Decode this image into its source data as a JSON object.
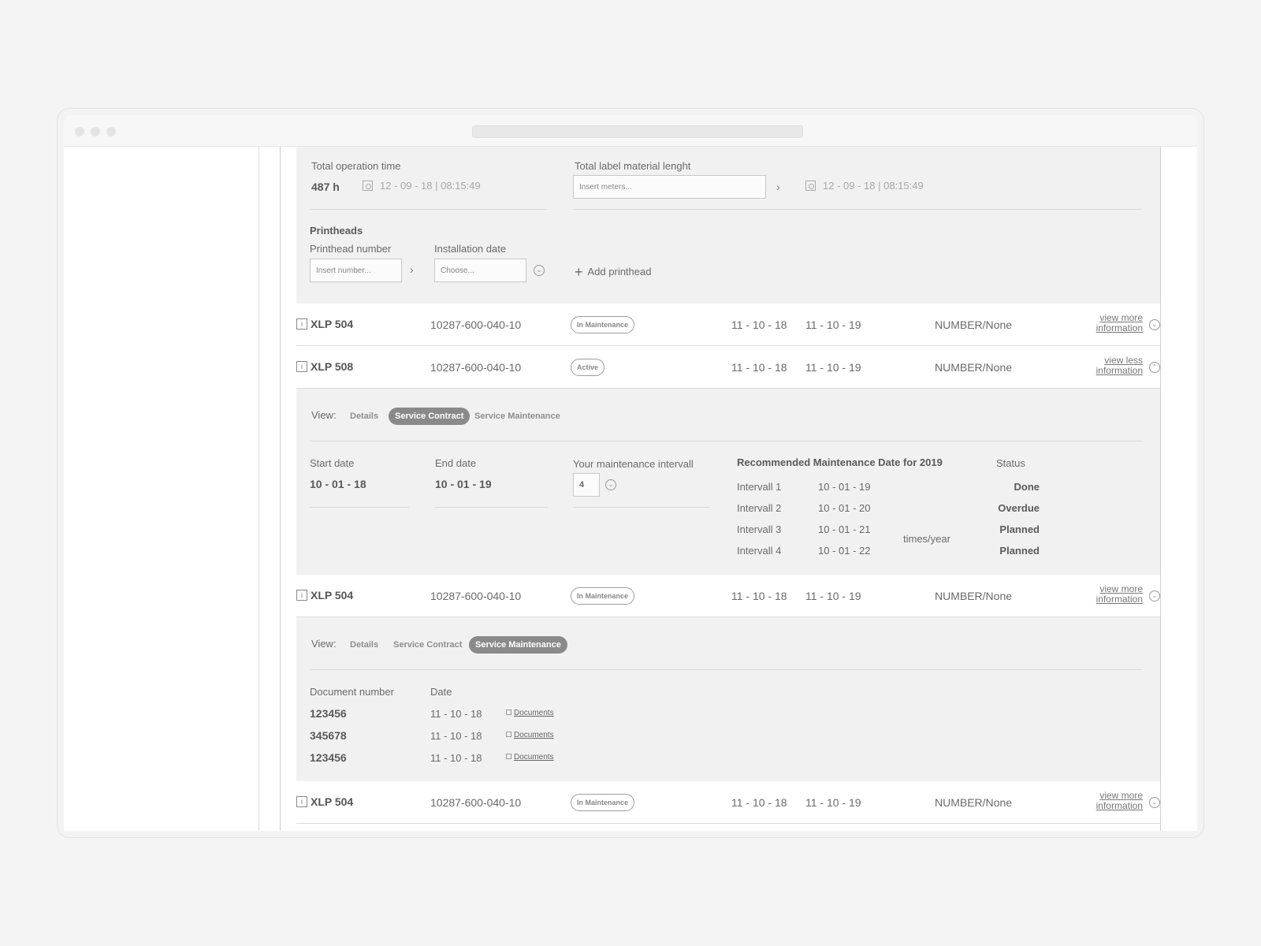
{
  "stats": {
    "operation_time_label": "Total operation time",
    "operation_time_value": "487 h",
    "operation_time_stamp": "12 - 09 - 18 | 08:15:49",
    "label_material_label": "Total label material lenght",
    "label_material_placeholder": "Insert meters...",
    "label_material_stamp": "12 - 09 - 18 | 08:15:49"
  },
  "printheads": {
    "title": "Printheads",
    "number_label": "Printhead number",
    "number_placeholder": "Insert number...",
    "date_label": "Installation date",
    "date_placeholder": "Choose...",
    "add_label": "Add printhead"
  },
  "rows": [
    {
      "name": "XLP 504",
      "serial": "10287-600-040-10",
      "status": "In Maintenance",
      "start": "11 - 10 - 18",
      "end": "11 - 10 - 19",
      "number": "NUMBER/None",
      "more1": "view more",
      "more2": "information"
    },
    {
      "name": "XLP 508",
      "serial": "10287-600-040-10",
      "status": "Active",
      "start": "11 - 10 - 18",
      "end": "11 - 10 - 19",
      "number": "NUMBER/None",
      "more1": "view less",
      "more2": "information"
    },
    {
      "name": "XLP 504",
      "serial": "10287-600-040-10",
      "status": "In Maintenance",
      "start": "11 - 10 - 18",
      "end": "11 - 10 - 19",
      "number": "NUMBER/None",
      "more1": "view more",
      "more2": "information"
    },
    {
      "name": "XLP 504",
      "serial": "10287-600-040-10",
      "status": "In Maintenance",
      "start": "11 - 10 - 18",
      "end": "11 - 10 - 19",
      "number": "NUMBER/None",
      "more1": "view more",
      "more2": "information"
    }
  ],
  "view": {
    "label": "View:",
    "tabs": [
      "Details",
      "Service Contract",
      "Service Maintenance"
    ]
  },
  "contract": {
    "start_label": "Start date",
    "start_value": "10 - 01 - 18",
    "end_label": "End date",
    "end_value": "10 - 01 - 19",
    "interval_label": "Your maintenance intervall",
    "interval_value": "4",
    "recommended_title": "Recommended Maintenance Date for 2019",
    "status_label": "Status",
    "times_label": "times/year",
    "intervals": [
      {
        "name": "Intervall 1",
        "date": "10 - 01 - 19",
        "status": "Done"
      },
      {
        "name": "Intervall 2",
        "date": "10 - 01 - 20",
        "status": "Overdue"
      },
      {
        "name": "Intervall 3",
        "date": "10 - 01 - 21",
        "status": "Planned"
      },
      {
        "name": "Intervall 4",
        "date": "10 - 01 - 22",
        "status": "Planned"
      }
    ]
  },
  "maintenance": {
    "doc_number_label": "Document number",
    "date_label": "Date",
    "link_label": "Documents",
    "documents": [
      {
        "number": "123456",
        "date": "11 - 10 - 18"
      },
      {
        "number": "345678",
        "date": "11 - 10 - 18"
      },
      {
        "number": "123456",
        "date": "11 - 10 - 18"
      }
    ]
  }
}
